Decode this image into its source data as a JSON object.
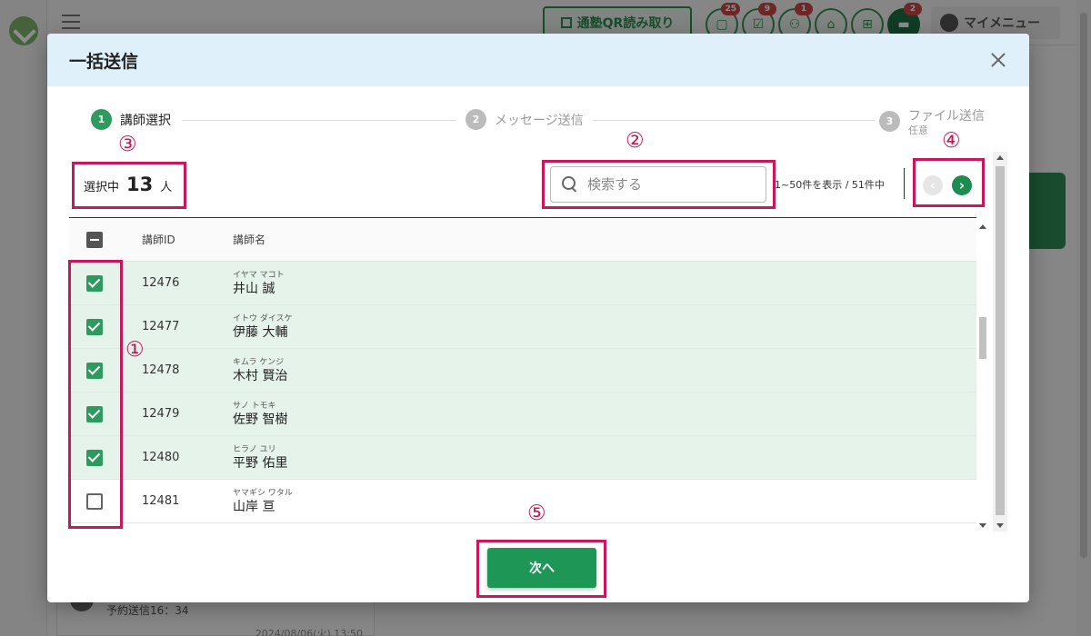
{
  "background": {
    "qr_button_label": "通塾QR読み取り",
    "header_badges": [
      "25",
      "9",
      "1",
      "2"
    ],
    "my_menu_label": "マイメニュー",
    "bottom_card_text": "予約送信16：34",
    "bottom_card_date": "2024/08/06(火) 13:50"
  },
  "modal": {
    "title": "一括送信",
    "steps": [
      {
        "number": "1",
        "label": "講師選択",
        "state": "active"
      },
      {
        "number": "2",
        "label": "メッセージ送信",
        "state": "inactive"
      },
      {
        "number": "3",
        "label": "ファイル送信",
        "sub": "任意",
        "state": "inactive"
      }
    ],
    "selection": {
      "label": "選択中",
      "count": "13",
      "unit": "人"
    },
    "search": {
      "placeholder": "検索する",
      "value": ""
    },
    "pagination": {
      "info": "1~50件を表示 / 51件中",
      "prev_icon": "chevron-left-icon",
      "next_icon": "chevron-right-icon"
    },
    "table": {
      "headers": {
        "id": "講師ID",
        "name": "講師名"
      },
      "rows": [
        {
          "id": "12476",
          "kana": "イヤマ マコト",
          "name": "井山 誠",
          "checked": true
        },
        {
          "id": "12477",
          "kana": "イトウ ダイスケ",
          "name": "伊藤 大輔",
          "checked": true
        },
        {
          "id": "12478",
          "kana": "キムラ ケンジ",
          "name": "木村 賢治",
          "checked": true
        },
        {
          "id": "12479",
          "kana": "サノ トモキ",
          "name": "佐野 智樹",
          "checked": true
        },
        {
          "id": "12480",
          "kana": "ヒラノ ユリ",
          "name": "平野 佑里",
          "checked": true
        },
        {
          "id": "12481",
          "kana": "ヤマギシ ワタル",
          "name": "山岸 亘",
          "checked": false
        }
      ]
    },
    "next_button_label": "次へ"
  },
  "annotations": {
    "n1": "①",
    "n2": "②",
    "n3": "③",
    "n4": "④",
    "n5": "⑤"
  },
  "colors": {
    "accent": "#1e9656",
    "annotation": "#c8175a",
    "header_bg": "#dff0fb",
    "selected_row": "#e5f3ea"
  }
}
